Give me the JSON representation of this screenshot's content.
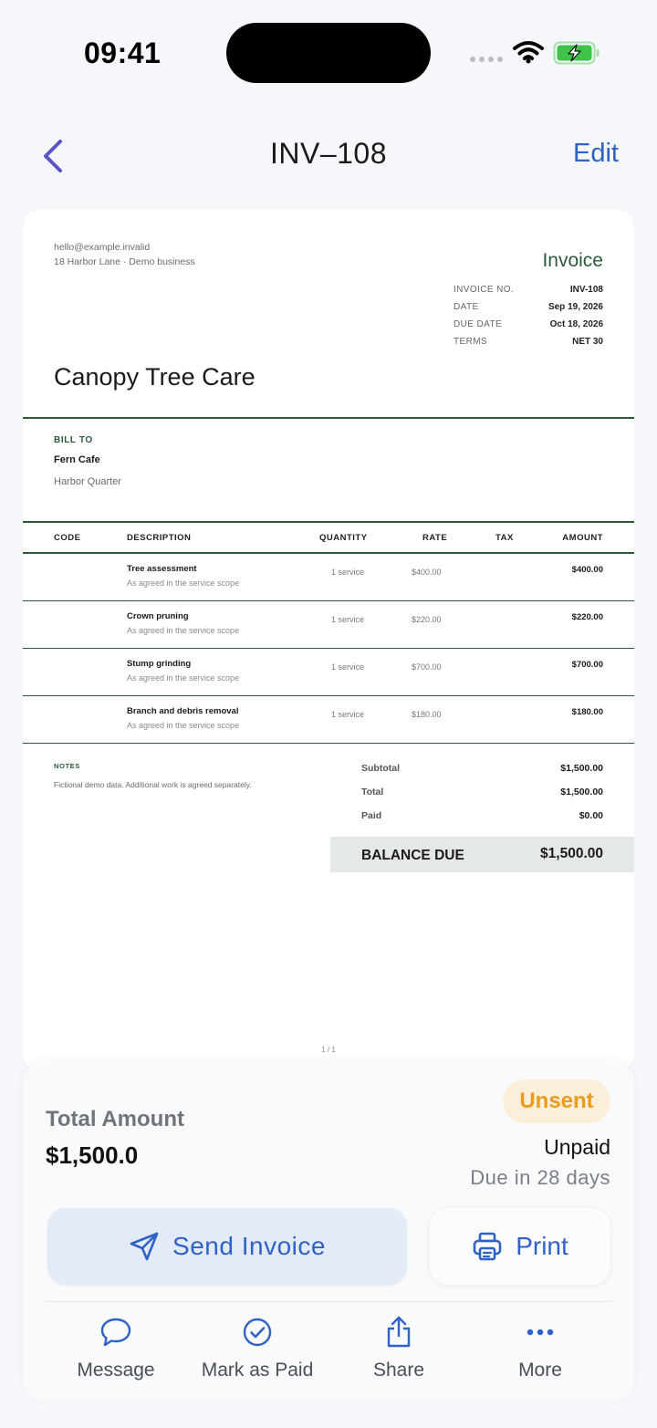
{
  "status_bar": {
    "time": "09:41"
  },
  "nav": {
    "title": "INV–108",
    "edit_label": "Edit"
  },
  "invoice": {
    "business_email": "hello@example.invalid",
    "business_address": "18 Harbor Lane · Demo business",
    "heading": "Invoice",
    "meta": [
      {
        "label": "INVOICE NO.",
        "value": "INV-108"
      },
      {
        "label": "DATE",
        "value": "Sep 19, 2026"
      },
      {
        "label": "DUE DATE",
        "value": "Oct 18, 2026"
      },
      {
        "label": "TERMS",
        "value": "NET 30"
      }
    ],
    "company_name": "Canopy Tree Care",
    "bill_to_label": "BILL TO",
    "bill_to_name": "Fern Cafe",
    "bill_to_address": "Harbor Quarter",
    "columns": {
      "code": "CODE",
      "description": "DESCRIPTION",
      "quantity": "QUANTITY",
      "rate": "RATE",
      "tax": "TAX",
      "amount": "AMOUNT"
    },
    "items": [
      {
        "description": "Tree assessment",
        "note": "As agreed in the service scope",
        "quantity": "1 service",
        "rate": "$400.00",
        "amount": "$400.00"
      },
      {
        "description": "Crown pruning",
        "note": "As agreed in the service scope",
        "quantity": "1 service",
        "rate": "$220.00",
        "amount": "$220.00"
      },
      {
        "description": "Stump grinding",
        "note": "As agreed in the service scope",
        "quantity": "1 service",
        "rate": "$700.00",
        "amount": "$700.00"
      },
      {
        "description": "Branch and debris removal",
        "note": "As agreed in the service scope",
        "quantity": "1 service",
        "rate": "$180.00",
        "amount": "$180.00"
      }
    ],
    "notes_label": "NOTES",
    "notes_text": "Fictional demo data. Additional work is agreed separately.",
    "subtotal_label": "Subtotal",
    "subtotal_value": "$1,500.00",
    "total_label": "Total",
    "total_value": "$1,500.00",
    "paid_label": "Paid",
    "paid_value": "$0.00",
    "balance_label": "BALANCE DUE",
    "balance_value": "$1,500.00",
    "page_indicator": "1 / 1"
  },
  "summary": {
    "total_label": "Total Amount",
    "total_value": "$1,500.0",
    "status_badge": "Unsent",
    "payment_status": "Unpaid",
    "due_text": "Due in 28 days"
  },
  "actions": {
    "send_label": "Send Invoice",
    "print_label": "Print",
    "message_label": "Message",
    "mark_paid_label": "Mark as Paid",
    "share_label": "Share",
    "more_label": "More"
  },
  "colors": {
    "accent": "#2f62c9",
    "invoice_green": "#2b5a3a",
    "badge_text": "#eb9c1e",
    "badge_bg": "#fcefd9"
  }
}
